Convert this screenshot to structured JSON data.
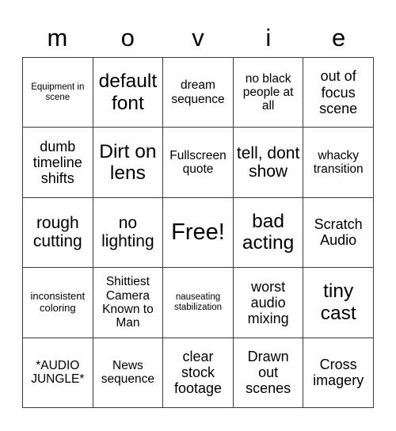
{
  "card": {
    "title_letters": [
      "m",
      "o",
      "v",
      "i",
      "e"
    ],
    "free_space_label": "Free!",
    "grid_size": "5x5",
    "colors": {
      "background": "#ffffff",
      "border": "#3a3a3a",
      "text": "#000000"
    },
    "rows": [
      [
        {
          "text": "Equipment in scene",
          "size": "xs"
        },
        {
          "text": "default font",
          "size": "xxl"
        },
        {
          "text": "dream sequence",
          "size": "m"
        },
        {
          "text": "no black people at all",
          "size": "m"
        },
        {
          "text": "out of focus scene",
          "size": "l"
        }
      ],
      [
        {
          "text": "dumb timeline shifts",
          "size": "l"
        },
        {
          "text": "Dirt on lens",
          "size": "xxl"
        },
        {
          "text": "Fullscreen quote",
          "size": "m"
        },
        {
          "text": "tell, dont show",
          "size": "xl"
        },
        {
          "text": "whacky transition",
          "size": "m"
        }
      ],
      [
        {
          "text": "rough cutting",
          "size": "xl"
        },
        {
          "text": "no lighting",
          "size": "xl"
        },
        {
          "text": "Free!",
          "size": "free"
        },
        {
          "text": "bad acting",
          "size": "xxl"
        },
        {
          "text": "Scratch Audio",
          "size": "l"
        }
      ],
      [
        {
          "text": "inconsistent coloring",
          "size": "s"
        },
        {
          "text": "Shittiest Camera Known to Man",
          "size": "m"
        },
        {
          "text": "nauseating stabilization",
          "size": "xs"
        },
        {
          "text": "worst audio mixing",
          "size": "l"
        },
        {
          "text": "tiny cast",
          "size": "xxl"
        }
      ],
      [
        {
          "text": "*AUDIO JUNGLE*",
          "size": "m"
        },
        {
          "text": "News sequence",
          "size": "m"
        },
        {
          "text": "clear stock footage",
          "size": "l"
        },
        {
          "text": "Drawn out scenes",
          "size": "l"
        },
        {
          "text": "Cross imagery",
          "size": "l"
        }
      ]
    ]
  }
}
